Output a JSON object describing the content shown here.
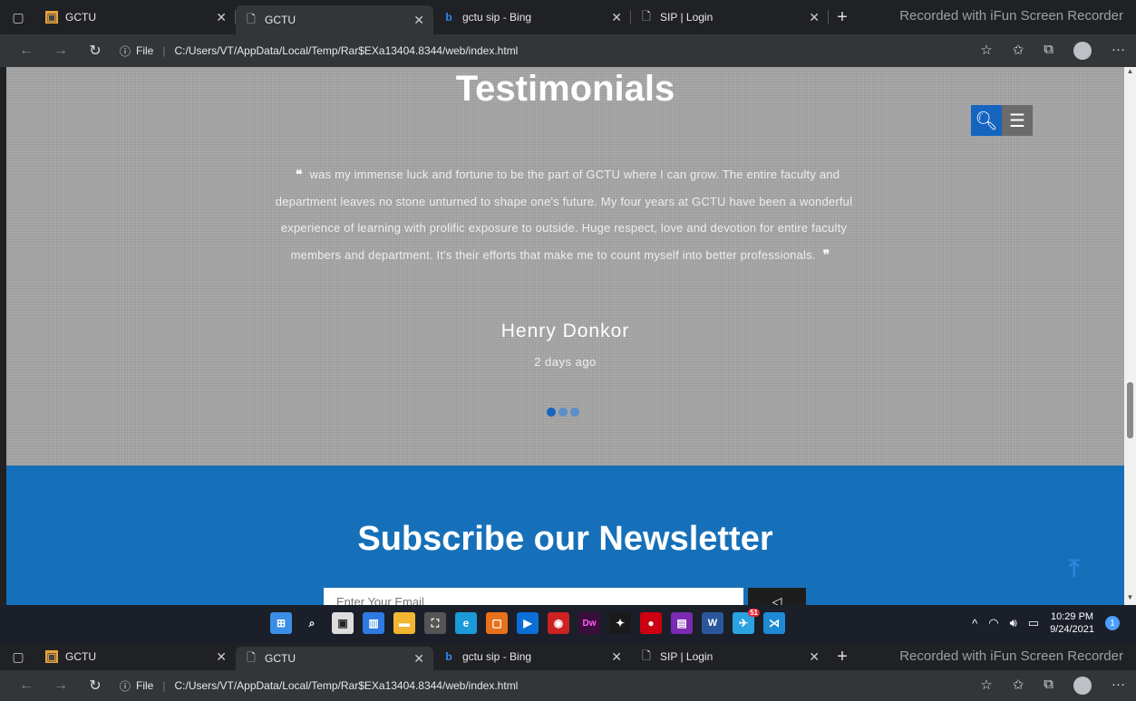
{
  "browser": {
    "tabs": [
      {
        "title": "GCTU",
        "active": false
      },
      {
        "title": "GCTU",
        "active": true
      },
      {
        "title": "gctu sip - Bing",
        "active": false
      },
      {
        "title": "SIP | Login",
        "active": false
      }
    ],
    "recorder_text": "Recorded with iFun Screen Recorder",
    "url_scheme": "File",
    "url": "C:/Users/VT/AppData/Local/Temp/Rar$EXa13404.8344/web/index.html"
  },
  "testimonials": {
    "title": "Testimonials",
    "quote": "was my immense luck and fortune to be the part of GCTU where I can grow. The entire faculty and department leaves no stone unturned to shape one's future. My four years at GCTU have been a wonderful experience of learning with prolific exposure to outside. Huge respect, love and devotion for entire faculty members and department. It's their efforts that make me to count myself into better professionals.",
    "open_quote": "❝",
    "close_quote": "❞",
    "author": "Henry Donkor",
    "time": "2 days ago",
    "slides": 3,
    "active_slide": 0
  },
  "newsletter": {
    "title": "Subscribe our Newsletter",
    "email_placeholder": "Enter Your Email"
  },
  "taskbar": {
    "time": "10:29 PM",
    "date": "9/24/2021",
    "notification_count": "1",
    "badge": "51"
  },
  "colors": {
    "accent_blue": "#1670b9",
    "button_blue": "#1565c0"
  }
}
